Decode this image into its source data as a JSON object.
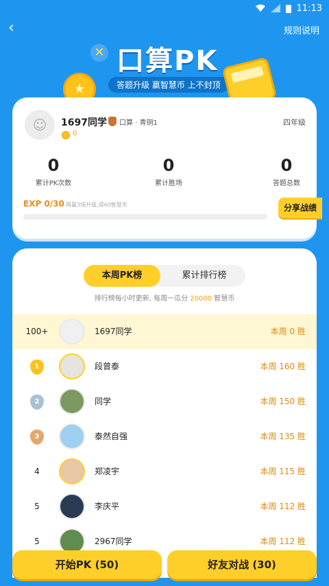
{
  "status": {
    "time": "11:13"
  },
  "header": {
    "rules": "规则说明",
    "title": "口算PK",
    "subtitle": "答题升级 赢智慧币 上不封顶"
  },
  "profile": {
    "name": "1697同学",
    "rank": "口算 · 青铜1",
    "grade": "四年级",
    "coins": "0",
    "stats": [
      {
        "value": "0",
        "label": "累计PK次数"
      },
      {
        "value": "0",
        "label": "累计胜场"
      },
      {
        "value": "0",
        "label": "答题总数"
      }
    ],
    "exp": "EXP 0/30",
    "exp_hint": "再赢3场升级,得60智慧币",
    "exp_progress": 0,
    "share": "分享战绩"
  },
  "leaderboard": {
    "tabs": [
      "本周PK榜",
      "累计排行榜"
    ],
    "active_tab": 0,
    "note_prefix": "排行榜每小时更新, 每周一瓜分",
    "note_amount": "20000",
    "note_suffix": "智慧币",
    "rows": [
      {
        "rank": "100+",
        "name": "1697同学",
        "wins": "本周 0 胜"
      },
      {
        "rank": "1",
        "name": "段曾泰",
        "wins": "本周 160 胜"
      },
      {
        "rank": "2",
        "name": "同学",
        "wins": "本周 150 胜"
      },
      {
        "rank": "3",
        "name": "泰然自强",
        "wins": "本周 135 胜"
      },
      {
        "rank": "4",
        "name": "郑凌宇",
        "wins": "本周 115 胜"
      },
      {
        "rank": "5",
        "name": "李庆平",
        "wins": "本周 112 胜"
      },
      {
        "rank": "5",
        "name": "2967同学",
        "wins": "本周 112 胜"
      }
    ]
  },
  "buttons": {
    "start": "开始PK (50)",
    "friend": "好友对战 (30)"
  }
}
